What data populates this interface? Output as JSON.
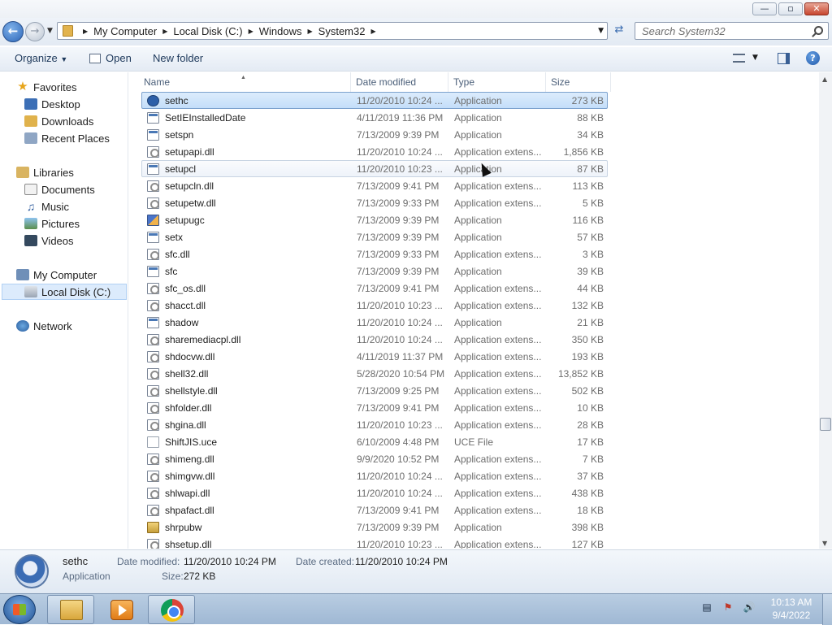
{
  "window": {
    "caption_min": "—",
    "caption_max": "▫",
    "caption_close": "✕"
  },
  "address": {
    "crumbs": [
      "My Computer",
      "Local Disk (C:)",
      "Windows",
      "System32"
    ],
    "search_placeholder": "Search System32"
  },
  "toolbar": {
    "organize": "Organize",
    "open": "Open",
    "new_folder": "New folder"
  },
  "nav": {
    "favorites": "Favorites",
    "desktop": "Desktop",
    "downloads": "Downloads",
    "recent_places": "Recent Places",
    "libraries": "Libraries",
    "documents": "Documents",
    "music": "Music",
    "pictures": "Pictures",
    "videos": "Videos",
    "my_computer": "My Computer",
    "local_disk": "Local Disk (C:)",
    "network": "Network"
  },
  "columns": {
    "name": "Name",
    "date": "Date modified",
    "type": "Type",
    "size": "Size"
  },
  "files": [
    {
      "name": "sethc",
      "date": "11/20/2010 10:24 ...",
      "type": "Application",
      "size": "273 KB",
      "icon": "sethc-icon"
    },
    {
      "name": "SetIEInstalledDate",
      "date": "4/11/2019 11:36 PM",
      "type": "Application",
      "size": "88 KB",
      "icon": "app-icon"
    },
    {
      "name": "setspn",
      "date": "7/13/2009 9:39 PM",
      "type": "Application",
      "size": "34 KB",
      "icon": "app-icon"
    },
    {
      "name": "setupapi.dll",
      "date": "11/20/2010 10:24 ...",
      "type": "Application extens...",
      "size": "1,856 KB",
      "icon": "dll-icon"
    },
    {
      "name": "setupcl",
      "date": "11/20/2010 10:23 ...",
      "type": "Application",
      "size": "87 KB",
      "icon": "app-icon"
    },
    {
      "name": "setupcln.dll",
      "date": "7/13/2009 9:41 PM",
      "type": "Application extens...",
      "size": "113 KB",
      "icon": "dll-icon"
    },
    {
      "name": "setupetw.dll",
      "date": "7/13/2009 9:33 PM",
      "type": "Application extens...",
      "size": "5 KB",
      "icon": "dll-icon"
    },
    {
      "name": "setupugc",
      "date": "7/13/2009 9:39 PM",
      "type": "Application",
      "size": "116 KB",
      "icon": "setup-icon"
    },
    {
      "name": "setx",
      "date": "7/13/2009 9:39 PM",
      "type": "Application",
      "size": "57 KB",
      "icon": "app-icon"
    },
    {
      "name": "sfc.dll",
      "date": "7/13/2009 9:33 PM",
      "type": "Application extens...",
      "size": "3 KB",
      "icon": "dll-icon"
    },
    {
      "name": "sfc",
      "date": "7/13/2009 9:39 PM",
      "type": "Application",
      "size": "39 KB",
      "icon": "app-icon"
    },
    {
      "name": "sfc_os.dll",
      "date": "7/13/2009 9:41 PM",
      "type": "Application extens...",
      "size": "44 KB",
      "icon": "dll-icon"
    },
    {
      "name": "shacct.dll",
      "date": "11/20/2010 10:23 ...",
      "type": "Application extens...",
      "size": "132 KB",
      "icon": "dll-icon"
    },
    {
      "name": "shadow",
      "date": "11/20/2010 10:24 ...",
      "type": "Application",
      "size": "21 KB",
      "icon": "app-icon"
    },
    {
      "name": "sharemediacpl.dll",
      "date": "11/20/2010 10:24 ...",
      "type": "Application extens...",
      "size": "350 KB",
      "icon": "dll-icon"
    },
    {
      "name": "shdocvw.dll",
      "date": "4/11/2019 11:37 PM",
      "type": "Application extens...",
      "size": "193 KB",
      "icon": "dll-icon"
    },
    {
      "name": "shell32.dll",
      "date": "5/28/2020 10:54 PM",
      "type": "Application extens...",
      "size": "13,852 KB",
      "icon": "dll-icon"
    },
    {
      "name": "shellstyle.dll",
      "date": "7/13/2009 9:25 PM",
      "type": "Application extens...",
      "size": "502 KB",
      "icon": "dll-icon"
    },
    {
      "name": "shfolder.dll",
      "date": "7/13/2009 9:41 PM",
      "type": "Application extens...",
      "size": "10 KB",
      "icon": "dll-icon"
    },
    {
      "name": "shgina.dll",
      "date": "11/20/2010 10:23 ...",
      "type": "Application extens...",
      "size": "28 KB",
      "icon": "dll-icon"
    },
    {
      "name": "ShiftJIS.uce",
      "date": "6/10/2009 4:48 PM",
      "type": "UCE File",
      "size": "17 KB",
      "icon": "file-icon"
    },
    {
      "name": "shimeng.dll",
      "date": "9/9/2020 10:52 PM",
      "type": "Application extens...",
      "size": "7 KB",
      "icon": "dll-icon"
    },
    {
      "name": "shimgvw.dll",
      "date": "11/20/2010 10:24 ...",
      "type": "Application extens...",
      "size": "37 KB",
      "icon": "dll-icon"
    },
    {
      "name": "shlwapi.dll",
      "date": "11/20/2010 10:24 ...",
      "type": "Application extens...",
      "size": "438 KB",
      "icon": "dll-icon"
    },
    {
      "name": "shpafact.dll",
      "date": "7/13/2009 9:41 PM",
      "type": "Application extens...",
      "size": "18 KB",
      "icon": "dll-icon"
    },
    {
      "name": "shrpubw",
      "date": "7/13/2009 9:39 PM",
      "type": "Application",
      "size": "398 KB",
      "icon": "shrpubw-icon"
    },
    {
      "name": "shsetup.dll",
      "date": "11/20/2010 10:23 ...",
      "type": "Application extens...",
      "size": "127 KB",
      "icon": "dll-icon"
    }
  ],
  "selected_index": 0,
  "hover_index": 4,
  "details": {
    "name": "sethc",
    "type": "Application",
    "date_modified_label": "Date modified:",
    "date_modified": "11/20/2010 10:24 PM",
    "date_created_label": "Date created:",
    "date_created": "11/20/2010 10:24 PM",
    "size_label": "Size:",
    "size": "272 KB"
  },
  "taskbar": {
    "time": "10:13 AM",
    "date": "9/4/2022"
  }
}
